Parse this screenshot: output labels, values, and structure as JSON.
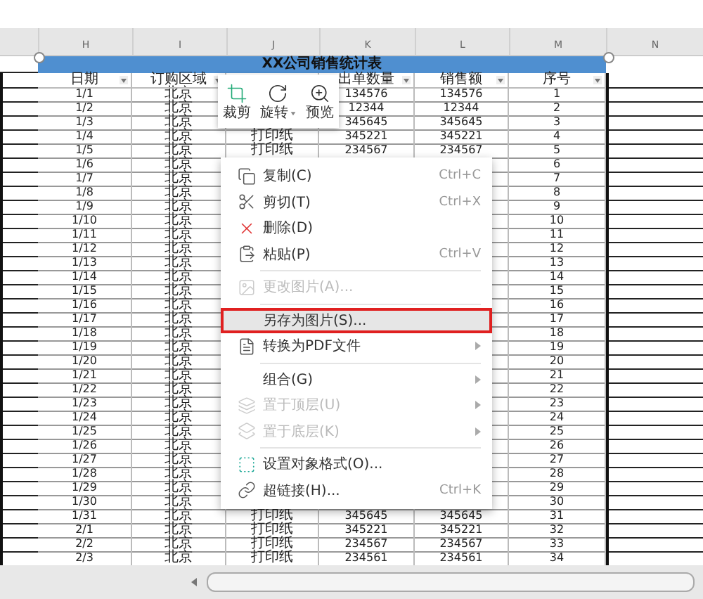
{
  "column_headers": [
    "H",
    "I",
    "J",
    "K",
    "L",
    "M",
    "N"
  ],
  "table": {
    "title": "XX公司销售统计表",
    "columns": [
      {
        "label": "日期"
      },
      {
        "label": "订购区域"
      },
      {},
      {
        "label": "出单数量"
      },
      {
        "label": "销售额"
      },
      {
        "label": "序号"
      }
    ],
    "rows": [
      {
        "date": "1/1",
        "region": "北京",
        "quantity": "134576",
        "amount": "134576",
        "number": "1"
      },
      {
        "date": "1/2",
        "region": "北京",
        "quantity": "12344",
        "amount": "12344",
        "number": "2"
      },
      {
        "date": "1/3",
        "region": "北京",
        "quantity": "345645",
        "amount": "345645",
        "number": "3"
      },
      {
        "date": "1/4",
        "region": "北京",
        "column_3": "打印纸",
        "quantity": "345221",
        "amount": "345221",
        "number": "4"
      },
      {
        "date": "1/5",
        "region": "北京",
        "column_3": "打印纸",
        "quantity": "234567",
        "amount": "234567",
        "number": "5"
      },
      {
        "date": "1/6",
        "region": "北京",
        "number": "6"
      },
      {
        "date": "1/7",
        "region": "北京",
        "number": "7"
      },
      {
        "date": "1/8",
        "region": "北京",
        "number": "8"
      },
      {
        "date": "1/9",
        "region": "北京",
        "number": "9"
      },
      {
        "date": "1/10",
        "region": "北京",
        "number": "10"
      },
      {
        "date": "1/11",
        "region": "北京",
        "number": "11"
      },
      {
        "date": "1/12",
        "region": "北京",
        "number": "12"
      },
      {
        "date": "1/13",
        "region": "北京",
        "number": "13"
      },
      {
        "date": "1/14",
        "region": "北京",
        "number": "14"
      },
      {
        "date": "1/15",
        "region": "北京",
        "number": "15"
      },
      {
        "date": "1/16",
        "region": "北京",
        "number": "16"
      },
      {
        "date": "1/17",
        "region": "北京",
        "number": "17"
      },
      {
        "date": "1/18",
        "region": "北京",
        "number": "18"
      },
      {
        "date": "1/19",
        "region": "北京",
        "number": "19"
      },
      {
        "date": "1/20",
        "region": "北京",
        "number": "20"
      },
      {
        "date": "1/21",
        "region": "北京",
        "number": "21"
      },
      {
        "date": "1/22",
        "region": "北京",
        "number": "22"
      },
      {
        "date": "1/23",
        "region": "北京",
        "number": "23"
      },
      {
        "date": "1/24",
        "region": "北京",
        "number": "24"
      },
      {
        "date": "1/25",
        "region": "北京",
        "number": "25"
      },
      {
        "date": "1/26",
        "region": "北京",
        "number": "26"
      },
      {
        "date": "1/27",
        "region": "北京",
        "number": "27"
      },
      {
        "date": "1/28",
        "region": "北京",
        "number": "28"
      },
      {
        "date": "1/29",
        "region": "北京",
        "number": "29"
      },
      {
        "date": "1/30",
        "region": "北京",
        "number": "30"
      },
      {
        "date": "1/31",
        "region": "北京",
        "column_3": "打印纸",
        "quantity": "345645",
        "amount": "345645",
        "number": "31"
      },
      {
        "date": "2/1",
        "region": "北京",
        "column_3": "打印纸",
        "quantity": "345221",
        "amount": "345221",
        "number": "32"
      },
      {
        "date": "2/2",
        "region": "北京",
        "column_3": "打印纸",
        "quantity": "234567",
        "amount": "234567",
        "number": "33"
      },
      {
        "date": "2/3",
        "region": "北京",
        "column_3": "打印纸",
        "quantity": "234561",
        "amount": "234561",
        "number": "34"
      }
    ]
  },
  "picture_toolbar": [
    {
      "label": "裁剪",
      "dropdown": false
    },
    {
      "label": "旋转",
      "dropdown": true
    },
    {
      "label": "预览",
      "dropdown": false
    }
  ],
  "context_menu": [
    {
      "kind": "item",
      "label": "复制(C)",
      "shortcut": "Ctrl+C",
      "disabled": false,
      "selected": false,
      "submenu": false
    },
    {
      "kind": "item",
      "label": "剪切(T)",
      "shortcut": "Ctrl+X",
      "disabled": false,
      "selected": false,
      "submenu": false
    },
    {
      "kind": "item",
      "label": "删除(D)",
      "disabled": false,
      "selected": false,
      "submenu": false
    },
    {
      "kind": "item",
      "label": "粘贴(P)",
      "shortcut": "Ctrl+V",
      "disabled": false,
      "selected": false,
      "submenu": false
    },
    {
      "kind": "separator"
    },
    {
      "kind": "item",
      "label": "更改图片(A)...",
      "disabled": true,
      "selected": false,
      "submenu": false
    },
    {
      "kind": "separator"
    },
    {
      "kind": "item",
      "label": "另存为图片(S)...",
      "disabled": false,
      "selected": true,
      "submenu": false
    },
    {
      "kind": "item",
      "label": "转换为PDF文件",
      "disabled": false,
      "selected": false,
      "submenu": true
    },
    {
      "kind": "separator"
    },
    {
      "kind": "item",
      "label": "组合(G)",
      "disabled": false,
      "selected": false,
      "submenu": true
    },
    {
      "kind": "item",
      "label": "置于顶层(U)",
      "disabled": true,
      "selected": false,
      "submenu": true
    },
    {
      "kind": "item",
      "label": "置于底层(K)",
      "disabled": true,
      "selected": false,
      "submenu": true
    },
    {
      "kind": "separator"
    },
    {
      "kind": "item",
      "label": "设置对象格式(O)...",
      "disabled": false,
      "selected": false,
      "submenu": false
    },
    {
      "kind": "item",
      "label": "超链接(H)...",
      "shortcut": "Ctrl+K",
      "disabled": false,
      "selected": false,
      "submenu": false
    }
  ]
}
